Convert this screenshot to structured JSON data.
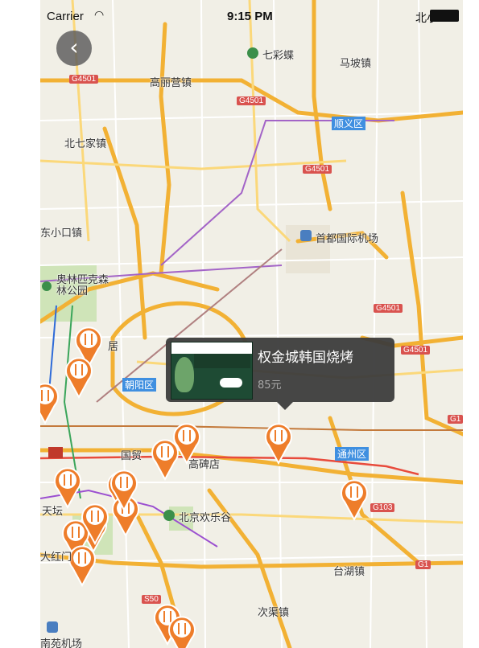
{
  "status_bar": {
    "carrier": "Carrier",
    "wifi_icon": "wifi-icon",
    "time": "9:15 PM",
    "right_text": "北小"
  },
  "nav": {
    "back_icon": "chevron-left-icon"
  },
  "map": {
    "place_labels": [
      "七彩蝶",
      "马坡镇",
      "高丽营镇",
      "顺义区",
      "北七家镇",
      "东小口镇",
      "首都国际机场",
      "奥林匹克森林公园",
      "朝阳区",
      "国贸",
      "高碑店",
      "通州区",
      "北京欢乐谷",
      "天坛",
      "大红门",
      "台湖镇",
      "次渠镇",
      "南苑机场",
      "居"
    ],
    "road_shields": [
      "G4501",
      "G4501",
      "G4501",
      "G4501",
      "G4501",
      "G103",
      "G1",
      "S50",
      "G1"
    ],
    "pin_icon": "restaurant-pin-icon",
    "pin_count": 17,
    "colors": {
      "highway": "#f2b134",
      "road": "#fbd87a",
      "rail_purple": "#a364c7",
      "rail_red": "#e84b3c",
      "pin": "#ee7d2a",
      "district_blue": "#3f8fe0"
    }
  },
  "callout": {
    "name": "权金城韩国烧烤",
    "price": "85元",
    "thumbnail": "restaurant-thumbnail"
  }
}
